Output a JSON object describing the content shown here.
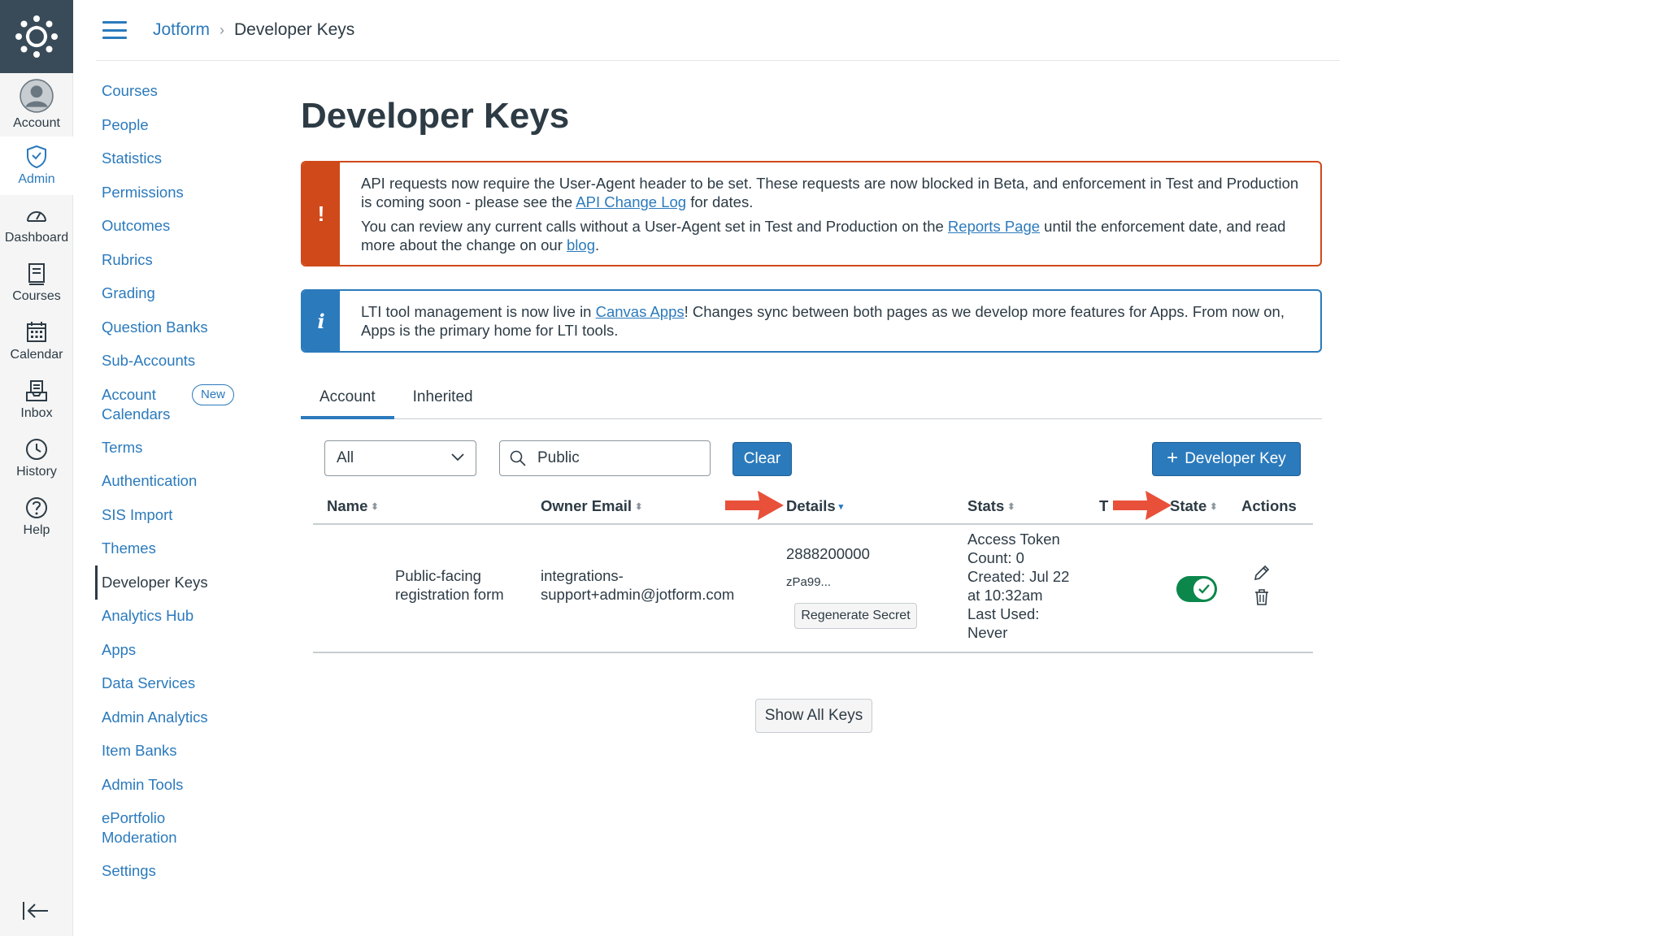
{
  "global_nav": {
    "items": [
      {
        "label": "Account",
        "icon": "user-avatar-icon"
      },
      {
        "label": "Admin",
        "icon": "shield-icon",
        "active": true
      },
      {
        "label": "Dashboard",
        "icon": "speedometer-icon"
      },
      {
        "label": "Courses",
        "icon": "book-icon"
      },
      {
        "label": "Calendar",
        "icon": "calendar-icon"
      },
      {
        "label": "Inbox",
        "icon": "inbox-icon"
      },
      {
        "label": "History",
        "icon": "clock-icon"
      },
      {
        "label": "Help",
        "icon": "help-icon"
      }
    ]
  },
  "breadcrumb": {
    "root": "Jotform",
    "separator": "›",
    "current": "Developer Keys"
  },
  "sub_nav": {
    "items": [
      {
        "label": "Courses"
      },
      {
        "label": "People"
      },
      {
        "label": "Statistics"
      },
      {
        "label": "Permissions"
      },
      {
        "label": "Outcomes"
      },
      {
        "label": "Rubrics"
      },
      {
        "label": "Grading"
      },
      {
        "label": "Question Banks"
      },
      {
        "label": "Sub-Accounts"
      },
      {
        "label": "Account Calendars",
        "badge": "New"
      },
      {
        "label": "Terms"
      },
      {
        "label": "Authentication"
      },
      {
        "label": "SIS Import"
      },
      {
        "label": "Themes"
      },
      {
        "label": "Developer Keys",
        "active": true
      },
      {
        "label": "Analytics Hub"
      },
      {
        "label": "Apps"
      },
      {
        "label": "Data Services"
      },
      {
        "label": "Admin Analytics"
      },
      {
        "label": "Item Banks"
      },
      {
        "label": "Admin Tools"
      },
      {
        "label": "ePortfolio Moderation"
      },
      {
        "label": "Settings"
      }
    ]
  },
  "page": {
    "title": "Developer Keys"
  },
  "alerts": {
    "warning": {
      "icon": "!",
      "p1_before": "API requests now require the User-Agent header to be set. These requests are now blocked in Beta, and enforcement in Test and Production is coming soon - please see the ",
      "p1_link": "API Change Log",
      "p1_after": " for dates.",
      "p2_before": "You can review any current calls without a User-Agent set in Test and Production on the ",
      "p2_link": "Reports Page",
      "p2_middle": " until the enforcement date, and read more about the change on our ",
      "p2_link2": "blog",
      "p2_after": "."
    },
    "info": {
      "icon": "i",
      "before": "LTI tool management is now live in ",
      "link": "Canvas Apps",
      "after": "! Changes sync between both pages as we develop more features for Apps. From now on, Apps is the primary home for LTI tools."
    }
  },
  "tabs": [
    {
      "label": "Account",
      "active": true
    },
    {
      "label": "Inherited"
    }
  ],
  "filters": {
    "type_select": "All",
    "search_value": "Public",
    "clear_label": "Clear",
    "add_key_label": "Developer Key"
  },
  "table": {
    "columns": {
      "name": "Name",
      "owner_email": "Owner Email",
      "details": "Details",
      "stats": "Stats",
      "type_truncated": "T",
      "state": "State",
      "actions": "Actions"
    },
    "rows": [
      {
        "name_line1": "Public-facing",
        "name_line2": "registration form",
        "email_line1": "integrations-",
        "email_line2": "support+admin@jotform.com",
        "details_id": "2888200000",
        "details_secret": "zPa99...",
        "regenerate_label": "Regenerate Secret",
        "stats_line1": "Access Token",
        "stats_line2": "Count: 0",
        "stats_line3": "Created: Jul 22",
        "stats_line4": "at 10:32am",
        "stats_line5": "Last Used:",
        "stats_line6": "Never",
        "state_on": true
      }
    ],
    "show_all_label": "Show All Keys"
  },
  "colors": {
    "brand_blue": "#2b7abc",
    "warning": "#d0491a",
    "success": "#0b874b",
    "annotation_arrow": "#e8503a"
  }
}
